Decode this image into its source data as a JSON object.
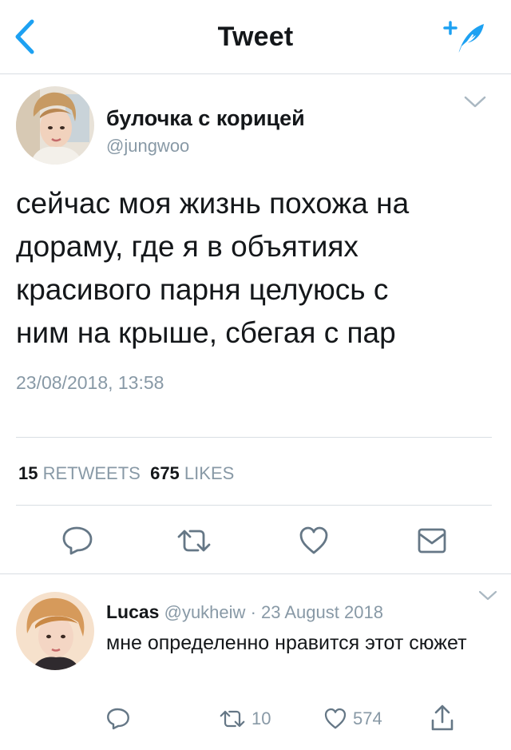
{
  "header": {
    "title": "Tweet",
    "back_icon": "chevron-left-icon",
    "compose_icon": "compose-feather-icon",
    "accent": "#1da1f2"
  },
  "tweet": {
    "author_name": "булочка с корицей",
    "author_handle": "@jungwoo",
    "text": "сейчас моя жизнь похожа на\nдораму, где я в объятиях\nкрасивого парня целуюсь с\nним на крыше, сбегая с пар",
    "timestamp": "23/08/2018, 13:58",
    "retweets_count": "15",
    "retweets_label": "RETWEETS",
    "likes_count": "675",
    "likes_label": "LIKES",
    "actions": [
      "reply-icon",
      "retweet-icon",
      "heart-icon",
      "envelope-icon"
    ]
  },
  "reply": {
    "author_name": "Lucas",
    "author_handle": "@yukheiw",
    "separator": "·",
    "date": "23 August 2018",
    "text": "мне определенно нравится этот сюжет",
    "retweets": "10",
    "likes": "574",
    "actions": [
      "reply-icon",
      "retweet-icon",
      "heart-icon",
      "share-icon"
    ]
  },
  "colors": {
    "text": "#14171a",
    "secondary": "#8899a6",
    "icon": "#657786",
    "divider": "#d8dee3"
  }
}
